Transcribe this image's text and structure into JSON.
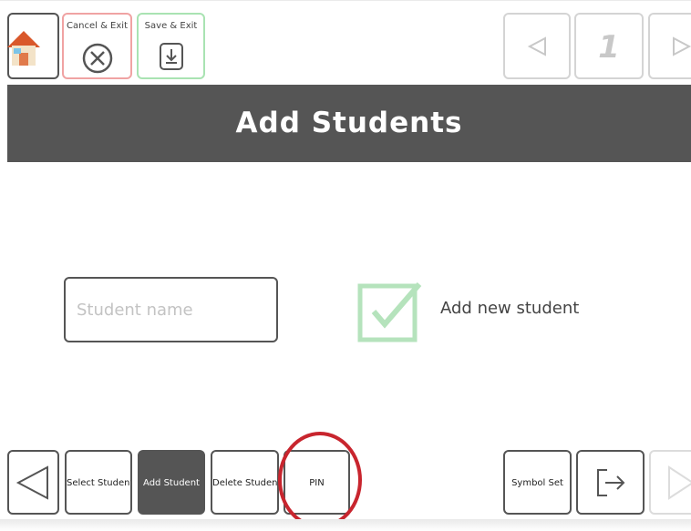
{
  "top_toolbar": {
    "home_icon": "house-icon",
    "cancel_exit_label": "Cancel & Exit",
    "cancel_icon": "circle-x-icon",
    "save_exit_label": "Save & Exit",
    "save_icon": "download-icon",
    "page_number": "1",
    "prev_icon": "triangle-left-icon",
    "next_icon": "triangle-right-icon"
  },
  "header": {
    "title": "Add Students"
  },
  "form": {
    "student_name_placeholder": "Student name",
    "student_name_value": "",
    "add_new_student_label": "Add new student",
    "check_icon": "checkbox-check-icon"
  },
  "bottom_toolbar": {
    "select_student_label": "Select Student",
    "add_student_label": "Add Student",
    "delete_student_label": "Delete Student",
    "pin_label": "PIN",
    "symbol_set_label": "Symbol Set",
    "exit_icon": "exit-arrow-icon"
  },
  "colors": {
    "header_bg": "#555555",
    "cancel_border": "#f0a3a3",
    "save_border": "#a9e3b2",
    "check_green": "#b5e3bc",
    "highlight_red": "#c8252e"
  }
}
